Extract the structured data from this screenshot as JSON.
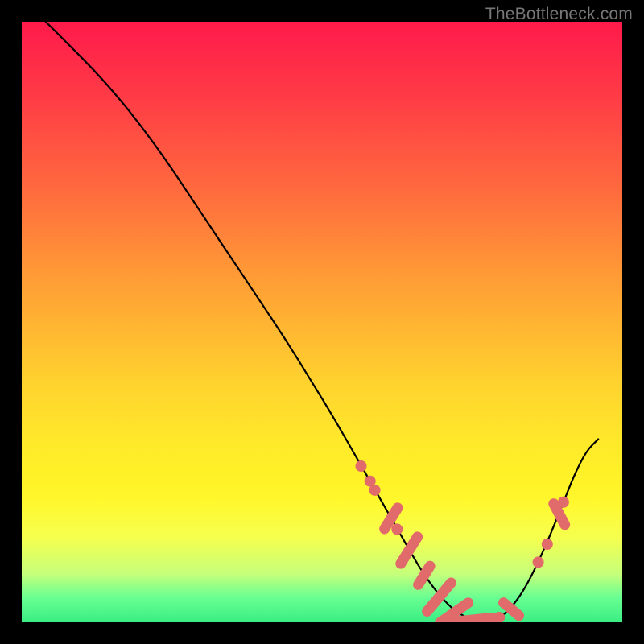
{
  "watermark": "TheBottleneck.com",
  "colors": {
    "marker": "#e16a6a",
    "curve": "#000000"
  },
  "chart_data": {
    "type": "line",
    "title": "",
    "xlabel": "",
    "ylabel": "",
    "xlim": [
      0,
      100
    ],
    "ylim": [
      0,
      100
    ],
    "grid": false,
    "legend": false,
    "series": [
      {
        "name": "bottleneck-curve",
        "x": [
          4,
          8,
          12,
          16,
          20,
          24,
          28,
          32,
          36,
          40,
          44,
          48,
          52,
          56,
          58,
          60,
          62,
          64,
          66,
          68,
          70,
          72,
          74,
          76,
          78,
          80,
          82,
          84,
          86,
          88,
          90,
          92,
          94,
          96
        ],
        "y": [
          100,
          96,
          92,
          87.5,
          82.5,
          77,
          71,
          65,
          59,
          53,
          47,
          40.5,
          34,
          27,
          23.5,
          20,
          16.5,
          13,
          9.5,
          6.5,
          4,
          2,
          0.8,
          0.3,
          0.3,
          1,
          3,
          6,
          10,
          14.5,
          19.5,
          24.5,
          28.5,
          30.5
        ]
      }
    ],
    "markers": [
      {
        "x": 56.5,
        "y": 26.0,
        "kind": "dot"
      },
      {
        "x": 58.0,
        "y": 23.5,
        "kind": "dot"
      },
      {
        "x": 58.8,
        "y": 22.0,
        "kind": "dot"
      },
      {
        "x": 61.5,
        "y": 17.3,
        "kind": "pill",
        "len": 2.5,
        "angle": -58
      },
      {
        "x": 62.5,
        "y": 15.5,
        "kind": "dot"
      },
      {
        "x": 64.5,
        "y": 12.0,
        "kind": "pill",
        "len": 3.2,
        "angle": -58
      },
      {
        "x": 67.0,
        "y": 7.8,
        "kind": "pill",
        "len": 2.2,
        "angle": -58
      },
      {
        "x": 69.5,
        "y": 4.2,
        "kind": "pill",
        "len": 3.8,
        "angle": -50
      },
      {
        "x": 72.0,
        "y": 1.6,
        "kind": "pill",
        "len": 3.5,
        "angle": -35
      },
      {
        "x": 75.0,
        "y": 0.4,
        "kind": "pill",
        "len": 4.0,
        "angle": -6
      },
      {
        "x": 78.5,
        "y": 0.5,
        "kind": "dot"
      },
      {
        "x": 79.5,
        "y": 0.8,
        "kind": "dot"
      },
      {
        "x": 81.5,
        "y": 2.2,
        "kind": "pill",
        "len": 2.0,
        "angle": 40
      },
      {
        "x": 86.0,
        "y": 10.0,
        "kind": "dot"
      },
      {
        "x": 87.5,
        "y": 13.0,
        "kind": "dot"
      },
      {
        "x": 89.5,
        "y": 18.0,
        "kind": "pill",
        "len": 2.4,
        "angle": 62
      },
      {
        "x": 90.2,
        "y": 20.0,
        "kind": "dot"
      }
    ]
  }
}
